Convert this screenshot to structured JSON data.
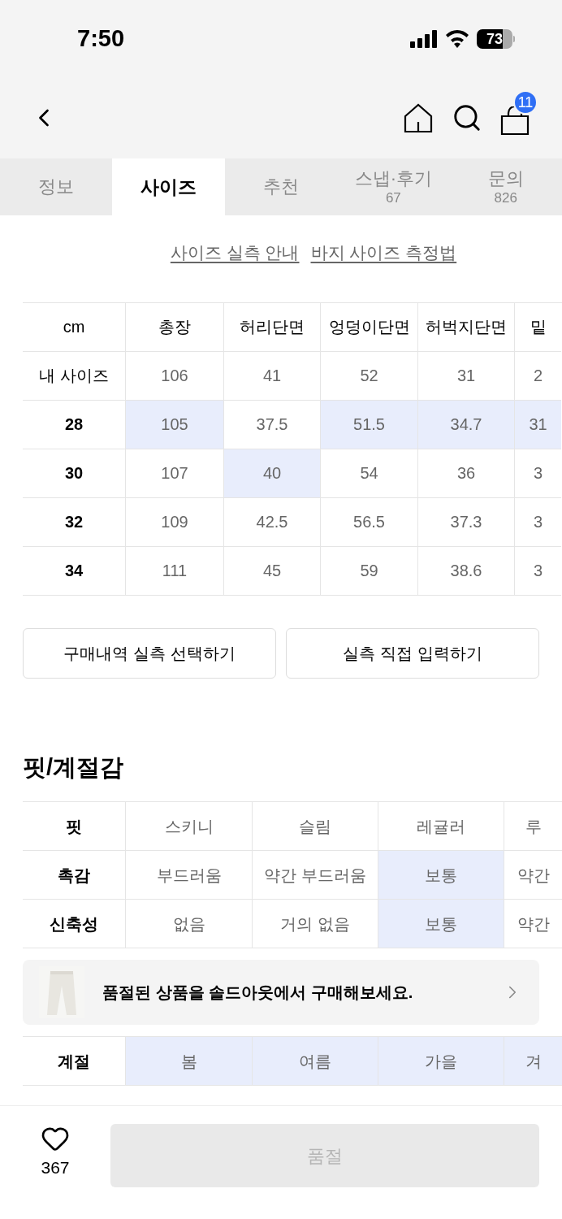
{
  "status_bar": {
    "time": "7:50",
    "battery": "73"
  },
  "nav": {
    "cart_badge": "11"
  },
  "tabs": [
    {
      "label": "정보",
      "selected": false
    },
    {
      "label": "사이즈",
      "selected": true
    },
    {
      "label": "추천",
      "selected": false
    },
    {
      "label": "스냅·후기",
      "count": "67",
      "selected": false
    },
    {
      "label": "문의",
      "count": "826",
      "selected": false
    }
  ],
  "links": [
    "사이즈 실측 안내",
    "바지 사이즈 측정법"
  ],
  "size_table": {
    "corner": "cm",
    "columns": [
      "총장",
      "허리단면",
      "엉덩이단면",
      "허벅지단면",
      "밑"
    ],
    "rows": [
      {
        "label": "내 사이즈",
        "kind": "mine",
        "cells": [
          {
            "text": "106",
            "selected": false
          },
          {
            "text": "41",
            "selected": false
          },
          {
            "text": "52",
            "selected": false
          },
          {
            "text": "31",
            "selected": false
          },
          {
            "text": "2",
            "selected": false
          }
        ]
      },
      {
        "label": "28",
        "kind": "size",
        "cells": [
          {
            "text": "105",
            "selected": true
          },
          {
            "text": "37.5",
            "selected": false
          },
          {
            "text": "51.5",
            "selected": true
          },
          {
            "text": "34.7",
            "selected": true
          },
          {
            "text": "31",
            "selected": true
          }
        ]
      },
      {
        "label": "30",
        "kind": "size",
        "cells": [
          {
            "text": "107",
            "selected": false
          },
          {
            "text": "40",
            "selected": true
          },
          {
            "text": "54",
            "selected": false
          },
          {
            "text": "36",
            "selected": false
          },
          {
            "text": "3",
            "selected": false
          }
        ]
      },
      {
        "label": "32",
        "kind": "size",
        "cells": [
          {
            "text": "109",
            "selected": false
          },
          {
            "text": "42.5",
            "selected": false
          },
          {
            "text": "56.5",
            "selected": false
          },
          {
            "text": "37.3",
            "selected": false
          },
          {
            "text": "3",
            "selected": false
          }
        ]
      },
      {
        "label": "34",
        "kind": "size",
        "cells": [
          {
            "text": "111",
            "selected": false
          },
          {
            "text": "45",
            "selected": false
          },
          {
            "text": "59",
            "selected": false
          },
          {
            "text": "38.6",
            "selected": false
          },
          {
            "text": "3",
            "selected": false
          }
        ]
      }
    ]
  },
  "actions": [
    "구매내역 실측 선택하기",
    "실측 직접 입력하기"
  ],
  "fit_section": {
    "title": "핏/계절감",
    "rows": [
      {
        "label": "핏",
        "cells": [
          {
            "text": "스키니",
            "selected": false
          },
          {
            "text": "슬림",
            "selected": false
          },
          {
            "text": "레귤러",
            "selected": false
          },
          {
            "text": "루",
            "selected": false
          }
        ]
      },
      {
        "label": "촉감",
        "cells": [
          {
            "text": "부드러움",
            "selected": false
          },
          {
            "text": "약간 부드러움",
            "selected": false
          },
          {
            "text": "보통",
            "selected": true
          },
          {
            "text": "약간",
            "selected": false
          }
        ]
      },
      {
        "label": "신축성",
        "cells": [
          {
            "text": "없음",
            "selected": false
          },
          {
            "text": "거의 없음",
            "selected": false
          },
          {
            "text": "보통",
            "selected": true
          },
          {
            "text": "약간",
            "selected": false
          }
        ]
      },
      {
        "label": "계절",
        "cells": [
          {
            "text": "봄",
            "selected": true
          },
          {
            "text": "여름",
            "selected": true
          },
          {
            "text": "가을",
            "selected": true
          },
          {
            "text": "겨",
            "selected": true
          }
        ]
      }
    ]
  },
  "toast": {
    "message": "품절된 상품을 솔드아웃에서 구매해보세요."
  },
  "bottom_bar": {
    "like_count": "367",
    "buy_button": {
      "label": "품절",
      "disabled": true
    }
  }
}
